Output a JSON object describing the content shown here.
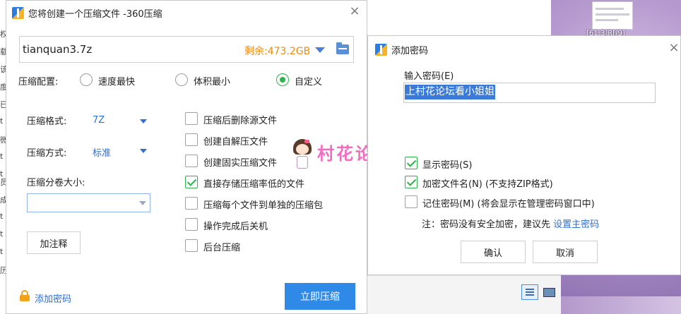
{
  "main_window": {
    "title": "您将创建一个压缩文件 -360压缩",
    "close": "×",
    "filename": "tianquan3.7z",
    "free_space": "剩余:473.2GB",
    "config_label": "压缩配置:",
    "config_options": [
      {
        "label": "速度最快",
        "selected": false
      },
      {
        "label": "体积最小",
        "selected": false
      },
      {
        "label": "自定义",
        "selected": true
      }
    ],
    "format_label": "压缩格式:",
    "format_value": "7Z",
    "method_label": "压缩方式:",
    "method_value": "标准",
    "split_label": "压缩分卷大小:",
    "split_value": "",
    "comment_button": "加注释",
    "options": [
      {
        "label": "压缩后删除源文件",
        "checked": false
      },
      {
        "label": "创建自解压文件",
        "checked": false
      },
      {
        "label": "创建固实压缩文件",
        "checked": false
      },
      {
        "label": "直接存储压缩率低的文件",
        "checked": true
      },
      {
        "label": "压缩每个文件到单独的压缩包",
        "checked": false
      },
      {
        "label": "操作完成后关机",
        "checked": false
      },
      {
        "label": "后台压缩",
        "checked": false
      }
    ],
    "add_password_link": "添加密码",
    "compress_button": "立即压缩"
  },
  "watermark": "村花论坛",
  "password_dialog": {
    "title": "添加密码",
    "close": "×",
    "input_label": "输入密码(E)",
    "input_value": "上村花论坛看小姐姐",
    "options": [
      {
        "label": "显示密码(S)",
        "checked": true
      },
      {
        "label": "加密文件名(N) (不支持ZIP格式)",
        "checked": true
      },
      {
        "label": "记住密码(M) (将会显示在管理密码窗口中)",
        "checked": false
      }
    ],
    "note": "注：密码没有安全加密，建议先 ",
    "note_link": "设置主密码",
    "ok_button": "确认",
    "cancel_button": "取消"
  },
  "background": {
    "left_strip_chars": [
      "权",
      "载",
      "该",
      "度",
      "已",
      "t",
      "微",
      "t",
      "t",
      "员",
      "成",
      "t",
      "t",
      "t",
      "历"
    ],
    "wallpaper_label": "[61:3]R[/9]"
  },
  "colors": {
    "accent_blue": "#2e8ae6",
    "link_blue": "#2d6fd1",
    "check_green": "#2eb34a",
    "free_space_orange": "#f08b0e",
    "watermark_pink": "#f46cc2"
  }
}
